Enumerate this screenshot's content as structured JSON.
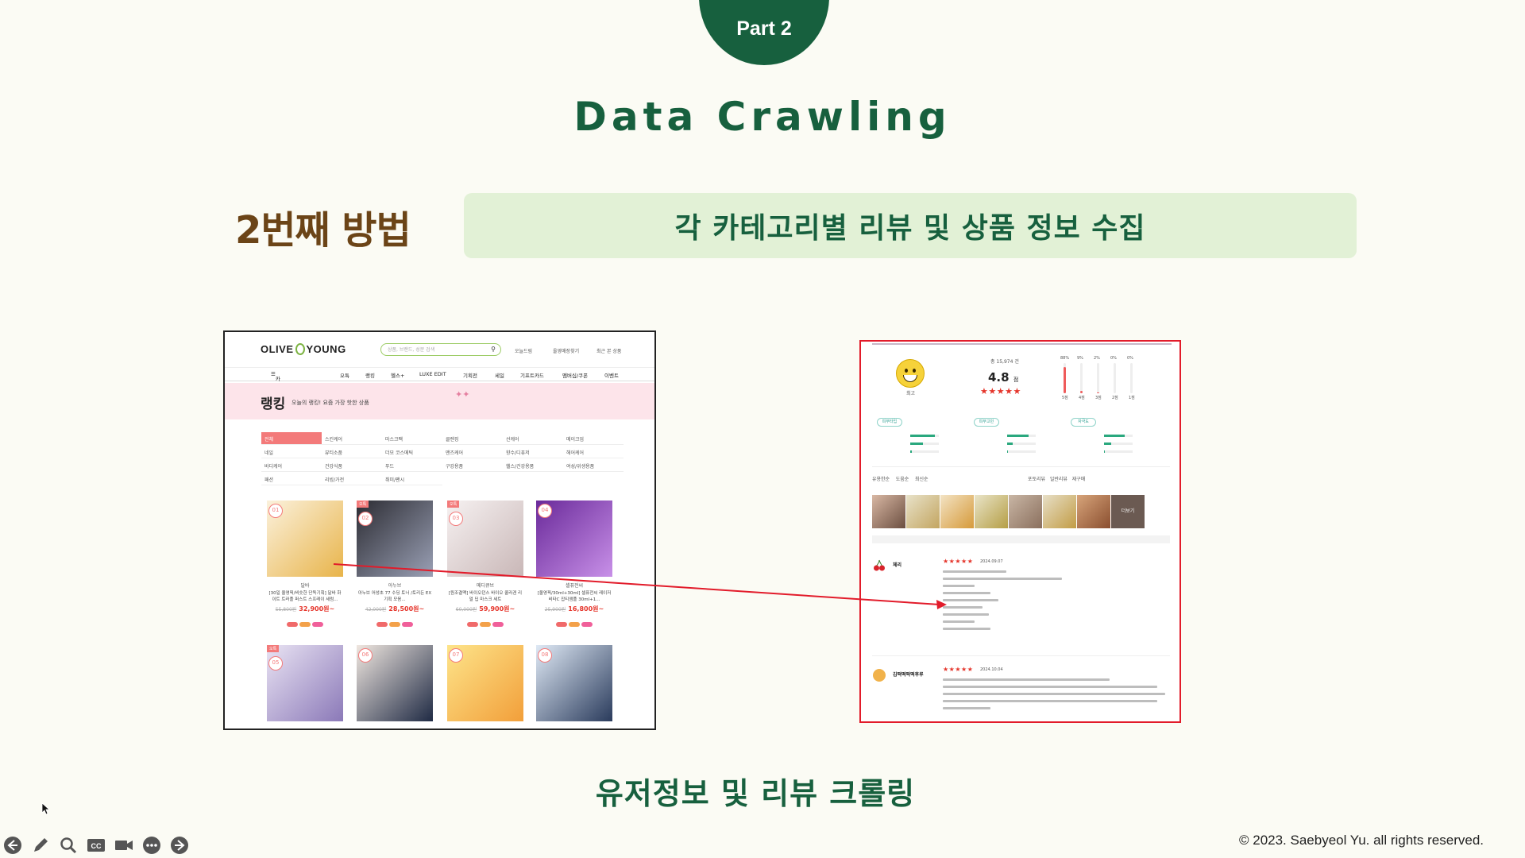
{
  "slide": {
    "part_label": "Part 2",
    "title": "Data Crawling",
    "method_title": "2번째 방법",
    "banner_text": "각 카테고리별 리뷰 및 상품 정보 수집",
    "caption": "유저정보 및 리뷰 크롤링",
    "copyright": "© 2023. Saebyeol Yu. all rights reserved.",
    "colors": {
      "accent_green": "#17603e",
      "banner_bg": "#e2f1d6",
      "method_brown": "#6b4417",
      "highlight_red": "#e21b2a"
    }
  },
  "olive_young": {
    "logo_left": "OLIVE",
    "logo_right": "YOUNG",
    "search_placeholder": "상품, 브랜드, 성분 검색",
    "util_links": [
      "오늘드림",
      "올영매장찾기",
      "최근 본 상품"
    ],
    "nav_category": "카테고리",
    "nav_items": [
      "오특",
      "랭킹",
      "헬스+",
      "LUXE EDIT",
      "기획전",
      "세일",
      "기프트카드",
      "멤버십/쿠폰",
      "이벤트"
    ],
    "page_title": "랭킹",
    "page_subtitle": "오늘의 랭킹! 요즘 가장 핫한 상품",
    "categories": [
      "전체",
      "스킨케어",
      "마스크팩",
      "클렌징",
      "선케어",
      "메이크업",
      "네일",
      "뷰티소품",
      "더모 코스메틱",
      "맨즈케어",
      "향수/디퓨저",
      "헤어케어",
      "바디케어",
      "건강식품",
      "푸드",
      "구강용품",
      "헬스/건강용품",
      "여성/위생용품",
      "패션",
      "리빙/가전",
      "취미/팬시"
    ],
    "products": [
      {
        "rank": "01",
        "brand": "달바",
        "name": "[30일 올영픽/비슷한 단독기획] 달바 화이트 트러플 퍼스트 스프레이 세럼...",
        "old_price": "55,800원",
        "new_price": "32,900원~"
      },
      {
        "rank": "02",
        "tag": "오특",
        "brand": "아누브",
        "name": "아누브 어성초 77 수딩 토너 /토리든 EX 기획 모음...",
        "old_price": "42,000원",
        "new_price": "28,500원~"
      },
      {
        "rank": "03",
        "tag": "오특",
        "brand": "메디큐브",
        "name": "[원조결맥] 바이오던스 바이오 콜라겐 리얼 딥 마스크 세트",
        "old_price": "60,000원",
        "new_price": "59,900원~"
      },
      {
        "rank": "04",
        "brand": "셀퓨전씨",
        "name": "[올영픽/30ml+30ml] 셀퓨전씨 레이저 비타C 잡티앰플 30ml+1...",
        "old_price": "25,900원",
        "new_price": "16,800원~"
      },
      {
        "rank": "05",
        "tag": "오특"
      },
      {
        "rank": "06"
      },
      {
        "rank": "07"
      },
      {
        "rank": "08"
      }
    ]
  },
  "review": {
    "satisfaction": "최고",
    "total_label": "총 15,974 건",
    "score": "4.8",
    "score_unit": "점",
    "distribution": [
      {
        "label": "5점",
        "pct": "88%",
        "value": 0.88
      },
      {
        "label": "4점",
        "pct": "9%",
        "value": 0.09
      },
      {
        "label": "3점",
        "pct": "2%",
        "value": 0.02
      },
      {
        "label": "2점",
        "pct": "0%",
        "value": 0.0
      },
      {
        "label": "1점",
        "pct": "0%",
        "value": 0.0
      }
    ],
    "attributes": [
      {
        "name": "피부타입",
        "bars": [
          0.87,
          0.44,
          0.05
        ]
      },
      {
        "name": "피부고민",
        "bars": [
          0.76,
          0.2,
          0.04
        ]
      },
      {
        "name": "자극도",
        "bars": [
          0.72,
          0.26,
          0.02
        ]
      }
    ],
    "tabs": [
      "유용한순",
      "도움순",
      "최신순"
    ],
    "filters": [
      "포토리뷰",
      "일반리뷰",
      "재구매"
    ],
    "photo_more": "더보기",
    "reviewers": [
      {
        "name": "체리",
        "stars": "★★★★★",
        "date": "2024.09.07"
      },
      {
        "name": "김떡떡떡떡후루",
        "stars": "★★★★★",
        "date": "2024.10.04"
      }
    ]
  },
  "toolbar_icons": [
    "back-icon",
    "pen-icon",
    "zoom-icon",
    "cc-icon",
    "video-icon",
    "more-icon",
    "forward-icon"
  ]
}
